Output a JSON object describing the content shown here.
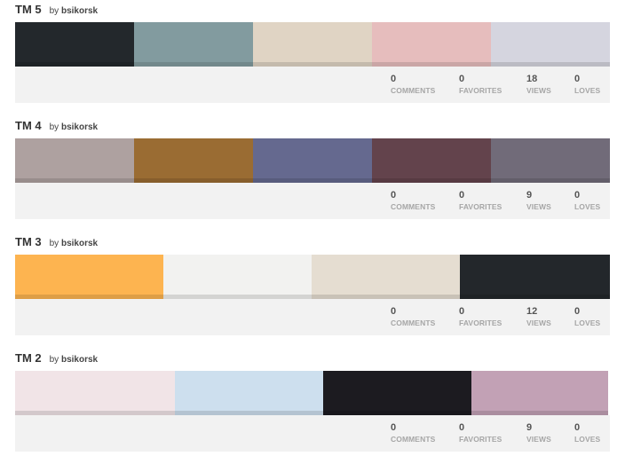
{
  "stat_labels": {
    "comments": "COMMENTS",
    "favorites": "FAVORITES",
    "views": "VIEWS",
    "loves": "LOVES"
  },
  "palettes": [
    {
      "title": "TM 5",
      "by_label": "by",
      "author": "bsikorsk",
      "colors": [
        "#23282c",
        "#829b9f",
        "#e0d4c4",
        "#e6bdbd",
        "#d5d5df"
      ],
      "stats": {
        "comments": "0",
        "favorites": "0",
        "views": "18",
        "loves": "0"
      }
    },
    {
      "title": "TM 4",
      "by_label": "by",
      "author": "bsikorsk",
      "colors": [
        "#aea1a0",
        "#9a6c33",
        "#65698f",
        "#63434c",
        "#716b79"
      ],
      "stats": {
        "comments": "0",
        "favorites": "0",
        "views": "9",
        "loves": "0"
      }
    },
    {
      "title": "TM 3",
      "by_label": "by",
      "author": "bsikorsk",
      "colors": [
        "#fdb450",
        "#f2f2f0",
        "#e5ddd1",
        "#23272b"
      ],
      "stats": {
        "comments": "0",
        "favorites": "0",
        "views": "12",
        "loves": "0"
      }
    },
    {
      "title": "TM 2",
      "by_label": "by",
      "author": "bsikorsk",
      "colors": [
        "#f1e4e7",
        "#cddfee",
        "#1c1b20",
        "#c2a1b5"
      ],
      "stats": {
        "comments": "0",
        "favorites": "0",
        "views": "9",
        "loves": "0"
      }
    }
  ]
}
